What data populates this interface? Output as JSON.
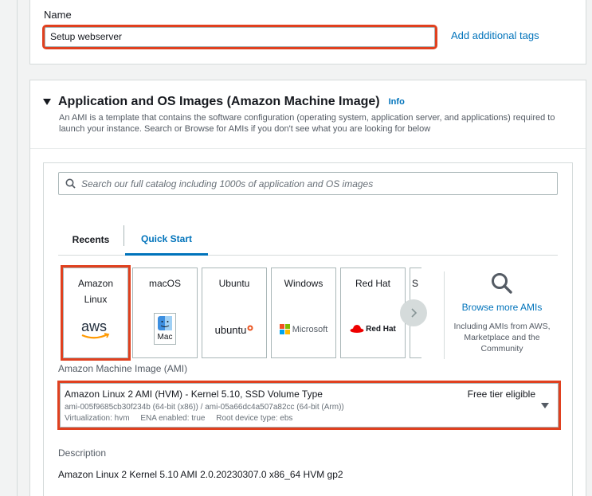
{
  "name_section": {
    "label": "Name",
    "value": "Setup webserver",
    "add_tags_link": "Add additional tags"
  },
  "ami_section": {
    "title": "Application and OS Images (Amazon Machine Image)",
    "info_link": "Info",
    "description": "An AMI is a template that contains the software configuration (operating system, application server, and applications) required to launch your instance. Search or Browse for AMIs if you don't see what you are looking for below",
    "search_placeholder": "Search our full catalog including 1000s of application and OS images",
    "tabs": [
      {
        "label": "Recents",
        "active": false
      },
      {
        "label": "Quick Start",
        "active": true
      }
    ],
    "os_tiles": [
      {
        "name_line1": "Amazon",
        "name_line2": "Linux",
        "logo_text": "aws",
        "selected": true,
        "icon": "aws-logo-icon"
      },
      {
        "name_line1": "macOS",
        "name_line2": "",
        "logo_text": "Mac",
        "selected": false,
        "icon": "mac-finder-icon"
      },
      {
        "name_line1": "Ubuntu",
        "name_line2": "",
        "logo_text": "ubuntu",
        "selected": false,
        "icon": "ubuntu-logo-icon"
      },
      {
        "name_line1": "Windows",
        "name_line2": "",
        "logo_text": "Microsoft",
        "selected": false,
        "icon": "microsoft-logo-icon"
      },
      {
        "name_line1": "Red Hat",
        "name_line2": "",
        "logo_text": "Red Hat",
        "selected": false,
        "icon": "redhat-logo-icon"
      },
      {
        "name_line1": "S",
        "name_line2": "",
        "logo_text": "",
        "selected": false,
        "icon": ""
      }
    ],
    "browse": {
      "link": "Browse more AMIs",
      "description": "Including AMIs from AWS, Marketplace and the Community"
    },
    "ami_label": "Amazon Machine Image (AMI)",
    "ami_selected": {
      "title": "Amazon Linux 2 AMI (HVM) - Kernel 5.10, SSD Volume Type",
      "badge": "Free tier eligible",
      "ids": "ami-005f9685cb30f234b (64-bit (x86)) / ami-05a66dc4a507a82cc (64-bit (Arm))",
      "virtualization": "Virtualization: hvm",
      "ena": "ENA enabled: true",
      "root_device": "Root device type: ebs"
    },
    "description_label": "Description",
    "description_value": "Amazon Linux 2 Kernel 5.10 AMI 2.0.20230307.0 x86_64 HVM gp2"
  },
  "colors": {
    "accent": "#0073bb",
    "highlight": "#e0401f",
    "border": "#aab7b8"
  }
}
